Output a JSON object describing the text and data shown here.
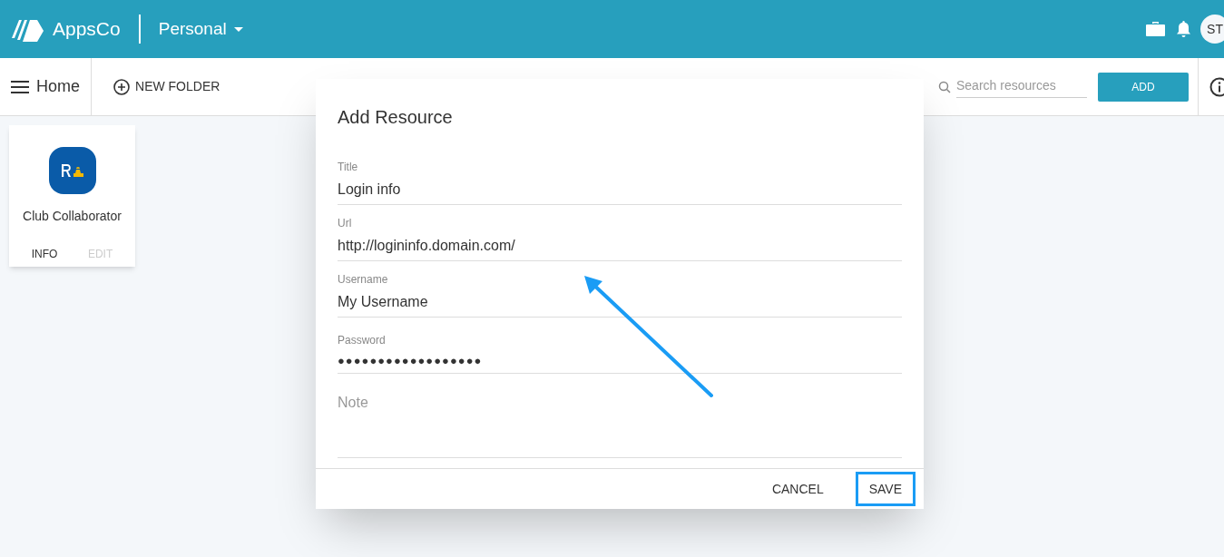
{
  "header": {
    "brand": "AppsCo",
    "workspace": "Personal",
    "avatar": "ST"
  },
  "toolbar": {
    "home": "Home",
    "new_folder": "NEW FOLDER",
    "search": {
      "placeholder": "Search resources"
    },
    "add": "ADD"
  },
  "cards": [
    {
      "title": "Club Collaborator",
      "actions": [
        {
          "label": "INFO",
          "disabled": false
        },
        {
          "label": "EDIT",
          "disabled": true
        }
      ]
    }
  ],
  "dialog": {
    "title": "Add Resource",
    "fields": [
      {
        "kind": "text",
        "label": "Title",
        "value": "Login info"
      },
      {
        "kind": "text",
        "label": "Url",
        "value": "http://logininfo.domain.com/"
      },
      {
        "kind": "text",
        "label": "Username",
        "value": "My Username"
      },
      {
        "kind": "password",
        "label": "Password",
        "value": "●●●●●●●●●●●●●●●●●●"
      },
      {
        "kind": "textarea",
        "placeholder": "Note"
      }
    ],
    "buttons": [
      {
        "label": "CANCEL",
        "highlighted": false
      },
      {
        "label": "SAVE",
        "highlighted": true
      }
    ]
  }
}
